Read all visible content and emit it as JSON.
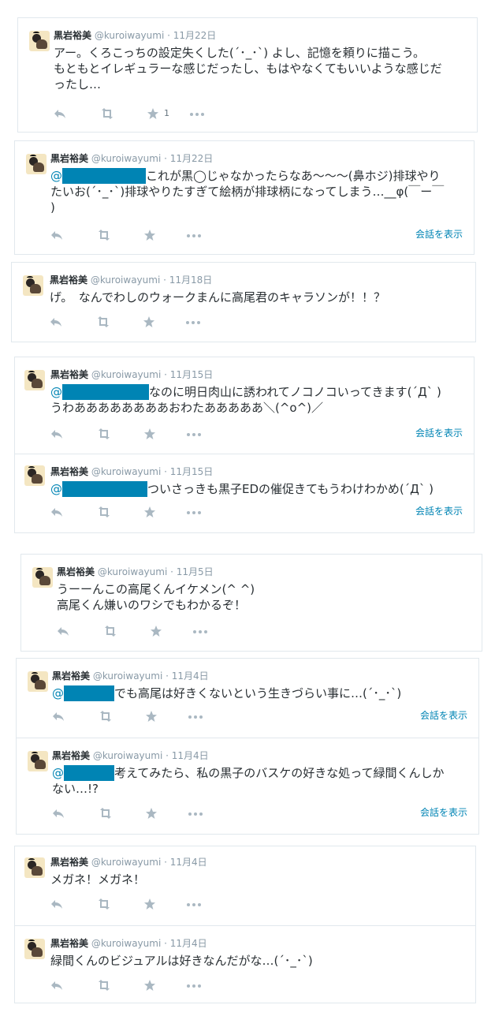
{
  "user": {
    "name": "黒岩裕美",
    "handle": "@kuroiwayumi"
  },
  "tweets": [
    {
      "date": "11月22日",
      "line1": "アー。くろこっちの設定失くした(´･_･`) よし、記憶を頼りに描こう。",
      "line2": "もともとイレギュラーな感じだったし、もはやなくてもいいような感じだ",
      "line3": "ったし…",
      "fav_count": "1"
    },
    {
      "date": "11月22日",
      "mention": "@",
      "line1_after": "これが黒◯じゃなかったらなあ〜〜〜(鼻ホジ)排球やり",
      "line2": "たいお(´･_･`)排球やりたすぎて絵柄が排球柄になってしまう…__φ(￣ー￣",
      "line3": ")",
      "conversation": "会話を表示"
    },
    {
      "date": "11月18日",
      "line1": "げ。　なんでわしのウォークまんに高尾君のキャラソンが！！？"
    },
    {
      "date": "11月15日",
      "mention": "@",
      "line1_after": "なのに明日肉山に誘われてノコノコいってきます(´Д` )",
      "line2": "うわああああああああおわたあああああ＼(^o^)／",
      "conversation": "会話を表示"
    },
    {
      "date": "11月15日",
      "mention": "@",
      "line1_after": "ついさっきも黒子EDの催促きてもうわけわかめ(´Д` )",
      "conversation": "会話を表示"
    },
    {
      "date": "11月5日",
      "line1": "うーーんこの高尾くんイケメン(^ ^)",
      "line2": "高尾くん嫌いのワシでもわかるぞ！"
    },
    {
      "date": "11月4日",
      "mention": "@",
      "line1_after": "でも高尾は好きくないという生きづらい事に…(´･_･`)",
      "conversation": "会話を表示"
    },
    {
      "date": "11月4日",
      "mention": "@",
      "line1_after": "考えてみたら、私の黒子のバスケの好きな処って緑間くんしか",
      "line2": "ない…!?",
      "conversation": "会話を表示"
    },
    {
      "date": "11月4日",
      "line1": "メガネ！メガネ！"
    },
    {
      "date": "11月4日",
      "line1": "緑間くんのビジュアルは好きなんだがな…(´･_･`)"
    }
  ],
  "separator": "·",
  "icons": [
    "reply-icon",
    "retweet-icon",
    "favorite-icon",
    "more-icon"
  ],
  "colors": {
    "link": "#0084b4",
    "meta": "#8899a6",
    "icon": "#aab8c2",
    "text": "#292f33",
    "border": "#e1e8ed"
  }
}
